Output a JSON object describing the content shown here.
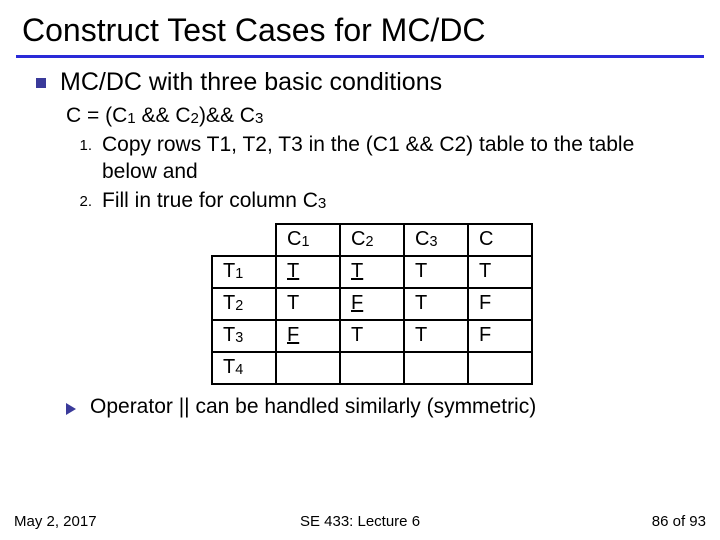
{
  "title": "Construct Test Cases for MC/DC",
  "bullet1": "MC/DC with three basic conditions",
  "equation_html": "C = (C<span class='sub'>1</span> && C<span class='sub'>2</span>)&& C<span class='sub'>3</span>",
  "steps": [
    {
      "n": "1.",
      "text_html": "Copy rows T1, T2, T3 in the (C1 && C2) table to the table below and"
    },
    {
      "n": "2.",
      "text_html": "Fill in true for column C<span class='sub'>3</span>"
    }
  ],
  "chart_data": {
    "type": "table",
    "columns_html": [
      "C<span class='sub'>1</span>",
      "C<span class='sub'>2</span>",
      "C<span class='sub'>3</span>",
      "C"
    ],
    "rows": [
      {
        "label_html": "T<span class='sub'>1</span>",
        "cells": [
          {
            "v": "T",
            "u": true
          },
          {
            "v": "T",
            "u": true
          },
          {
            "v": "T",
            "u": false
          },
          {
            "v": "T",
            "u": false
          }
        ]
      },
      {
        "label_html": "T<span class='sub'>2</span>",
        "cells": [
          {
            "v": "T",
            "u": false
          },
          {
            "v": "F",
            "u": true
          },
          {
            "v": "T",
            "u": false
          },
          {
            "v": "F",
            "u": false
          }
        ]
      },
      {
        "label_html": "T<span class='sub'>3</span>",
        "cells": [
          {
            "v": "F",
            "u": true
          },
          {
            "v": "T",
            "u": false
          },
          {
            "v": "T",
            "u": false
          },
          {
            "v": "F",
            "u": false
          }
        ]
      },
      {
        "label_html": "T<span class='sub'>4</span>",
        "cells": [
          {
            "v": "",
            "u": false
          },
          {
            "v": "",
            "u": false
          },
          {
            "v": "",
            "u": false
          },
          {
            "v": "",
            "u": false
          }
        ]
      }
    ]
  },
  "bullet2": "Operator || can be handled similarly (symmetric)",
  "footer": {
    "left": "May 2, 2017",
    "center": "SE 433: Lecture 6",
    "right": "86 of 93"
  }
}
